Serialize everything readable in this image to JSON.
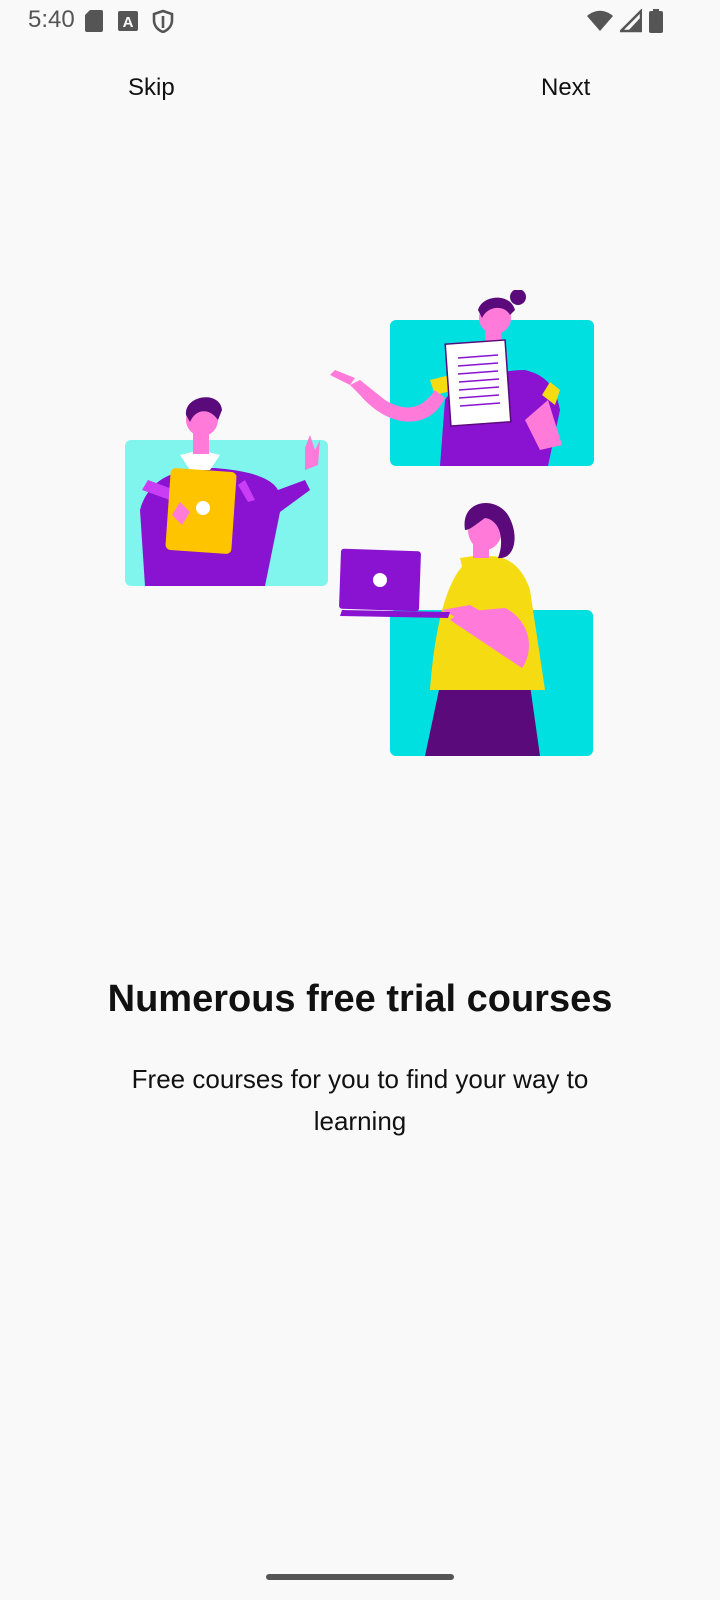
{
  "status_bar": {
    "time": "5:40",
    "left_icons": [
      "sd-card-icon",
      "font-a-icon",
      "shield-icon"
    ],
    "right_icons": [
      "wifi-icon",
      "cellular-signal-icon",
      "battery-icon"
    ]
  },
  "nav": {
    "skip_label": "Skip",
    "next_label": "Next"
  },
  "illustration": {
    "name": "people-learning-online-illustration",
    "colors": {
      "cyan": "#00e0e0",
      "light_cyan": "#7ff5ee",
      "purple": "#8a12d1",
      "dark_purple": "#5a0a7a",
      "pink": "#ff7ad9",
      "yellow": "#f5dc12",
      "orange_yellow": "#ffc400"
    }
  },
  "onboarding": {
    "title": "Numerous free trial courses",
    "subtitle": "Free courses for you to find your way to learning"
  }
}
